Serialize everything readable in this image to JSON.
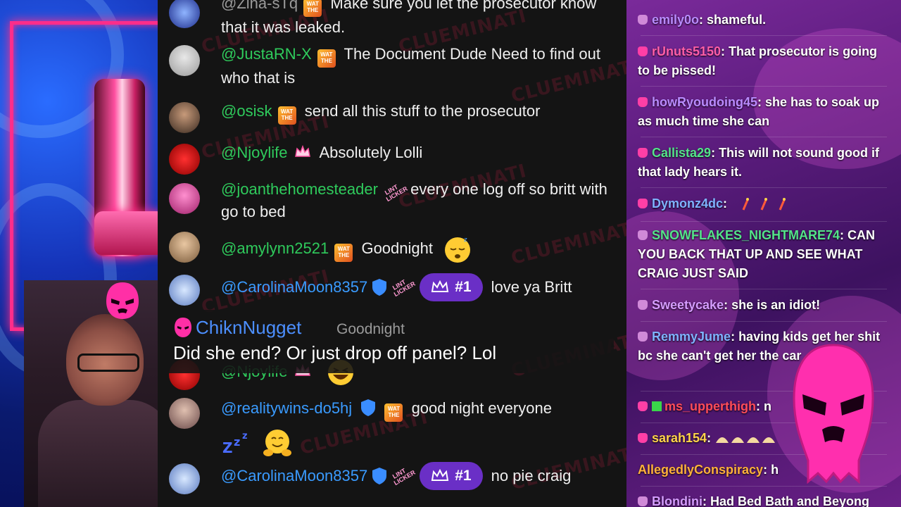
{
  "middle_chat": {
    "messages": [
      {
        "user": "@Zina-sTq",
        "badges": [
          "wat"
        ],
        "text": "Make sure you let the prosecutor know that it was leaked."
      },
      {
        "user": "@JustaRN-X",
        "badges": [
          "wat"
        ],
        "text": "The Document Dude Need to find out who that is"
      },
      {
        "user": "@osisk",
        "badges": [
          "wat"
        ],
        "text": "send all this stuff to the prosecutor"
      },
      {
        "user": "@Njoylife",
        "badges": [
          "crown"
        ],
        "text": "Absolutely Lolli"
      },
      {
        "user": "@joanthehomesteader",
        "badges": [
          "lint"
        ],
        "text": "every one log off so britt with go to bed"
      },
      {
        "user": "@amylynn2521",
        "badges": [
          "wat"
        ],
        "text": "Goodnight",
        "emoji": "sleepy"
      },
      {
        "user": "@CarolinaMoon8357",
        "badges": [
          "verified",
          "lint"
        ],
        "rank": "#1",
        "text": "love ya Britt"
      },
      {
        "user": "@Njoylife",
        "badges": [
          "crown"
        ],
        "text": "",
        "emoji": "laugh"
      },
      {
        "user": "@realitywins-do5hj",
        "badges": [
          "verified",
          "wat"
        ],
        "text": "good night everyone",
        "emoji": "zzz-hug"
      },
      {
        "user": "@CarolinaMoon8357",
        "badges": [
          "verified",
          "lint"
        ],
        "rank": "#1",
        "text": "no pie craig"
      }
    ],
    "badge_text": {
      "wat": "WAT THE",
      "lint": "LINT LICKER"
    },
    "watermark": {
      "part1": "CLUE",
      "part2": "MINATI"
    }
  },
  "caption_overlay": {
    "user": "ChiknNugget",
    "reply_preview": "Goodnight",
    "text": "Did she end? Or just drop off panel? Lol"
  },
  "right_chat": {
    "messages": [
      {
        "user": "emily0o",
        "color": "#b98bff",
        "text": "shameful."
      },
      {
        "user": "rUnuts5150",
        "color": "#ff5ea8",
        "text": "That prosecutor is going to be pissed!"
      },
      {
        "user": "howRyoudoing45",
        "color": "#b98bff",
        "text": "she has to soak up as much time she can"
      },
      {
        "user": "Callista29",
        "color": "#54e38a",
        "text": "This will not sound good if that lady hears it."
      },
      {
        "user": "Dymonz4dc",
        "color": "#7fb2ff",
        "text": ""
      },
      {
        "user": "SNOWFLAKES_NIGHTMARE74",
        "color": "#54e38a",
        "text": "CAN YOU BACK THAT UP AND SEE WHAT CRAIG JUST SAID"
      },
      {
        "user": "Sweetycake",
        "color": "#d59cff",
        "text": "she is an idiot!"
      },
      {
        "user": "RemmyJume",
        "color": "#7fb2ff",
        "text": "having kids get her shit bc she can't get her the car"
      },
      {
        "user": "ms_upperthigh",
        "color": "#ff4c5a",
        "text": "n"
      },
      {
        "user": "sarah154",
        "color": "#ffd34a",
        "text": ""
      },
      {
        "user": "AllegedlyConspiracy",
        "color": "#ffb13b",
        "text": "h"
      },
      {
        "user": "Blondini",
        "color": "#d59cff",
        "text": "Had Bed Bath and Beyong"
      }
    ]
  },
  "colors": {
    "middle_bg": "#141414",
    "username_green": "#2fcb5c",
    "username_blue": "#3a9bff",
    "rank_pill": "#6a2fc6",
    "accent_pink": "#ff2d8a",
    "right_bg": "#5b1c7d"
  }
}
